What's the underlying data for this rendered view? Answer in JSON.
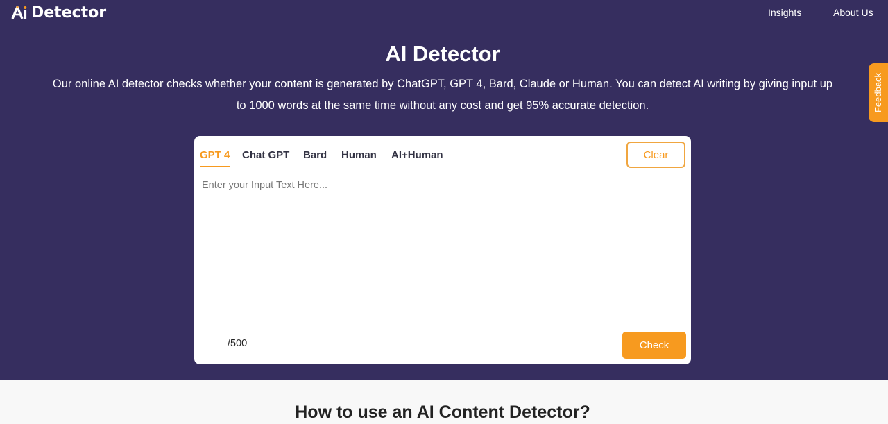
{
  "header": {
    "logo_text": "Detector",
    "logo_mark_text": "Ai",
    "nav": [
      {
        "label": "Insights"
      },
      {
        "label": "About Us"
      }
    ]
  },
  "feedback_label": "Feedback",
  "hero": {
    "title": "AI Detector",
    "description": "Our online AI detector checks whether your content is generated by ChatGPT, GPT 4, Bard, Claude or Human. You can detect AI writing by giving input up to 1000 words at the same time without any cost and get 95% accurate detection."
  },
  "detector": {
    "tabs": [
      {
        "label": "GPT 4",
        "active": true
      },
      {
        "label": "Chat GPT",
        "active": false
      },
      {
        "label": "Bard",
        "active": false
      },
      {
        "label": "Human",
        "active": false
      },
      {
        "label": "AI+Human",
        "active": false
      }
    ],
    "clear_label": "Clear",
    "input_placeholder": "Enter your Input Text Here...",
    "input_value": "",
    "word_count": "/500",
    "check_label": "Check"
  },
  "section": {
    "title": "How to use an AI Content Detector?"
  },
  "colors": {
    "hero_bg": "#362e5f",
    "accent": "#f79a1f",
    "page_bg": "#f8f8f8"
  }
}
